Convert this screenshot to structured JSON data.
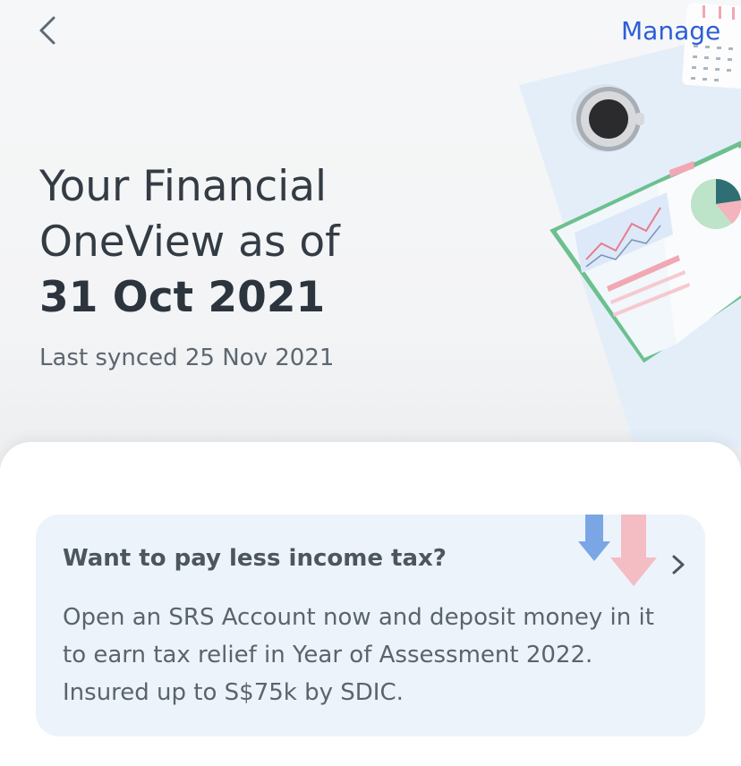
{
  "header": {
    "manage_label": "Manage",
    "title_line1": "Your Financial",
    "title_line2": "OneView as of",
    "title_date": "31 Oct 2021",
    "synced": "Last synced 25 Nov 2021"
  },
  "promo_card": {
    "title": "Want to pay less income tax?",
    "body": "Open an SRS Account now and deposit money in it to earn tax relief in Year of Assessment 2022. Insured up to S$75k by SDIC."
  },
  "icons": {
    "back": "chevron-left-icon",
    "card_action": "chevron-right-icon"
  },
  "colors": {
    "link": "#2c5ed6",
    "card_bg": "#edf3fb",
    "title_text": "#333c44"
  }
}
